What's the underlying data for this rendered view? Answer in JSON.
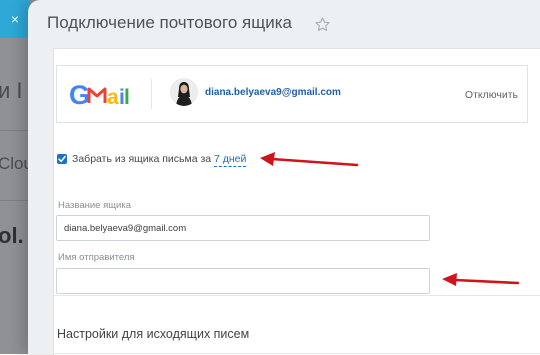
{
  "background_page": {
    "close_glyph": "×",
    "snippet_1": "и I",
    "snippet_2": "Clou",
    "snippet_3": "ol."
  },
  "panel": {
    "title": "Подключение почтового ящика",
    "star_icon": "star-outline-icon"
  },
  "account": {
    "logo_text": "Gmail",
    "email": "diana.belyaeva9@gmail.com",
    "disconnect_label": "Отключить"
  },
  "fetch": {
    "checked": true,
    "label": "Забрать из ящика письма за",
    "period": "7 дней"
  },
  "mailbox_name": {
    "label": "Название ящика",
    "value": "diana.belyaeva9@gmail.com"
  },
  "sender_name": {
    "label": "Имя отправителя",
    "value": ""
  },
  "outgoing": {
    "title": "Настройки для исходящих писем"
  },
  "colors": {
    "accent": "#1a73c8",
    "link": "#1a6fbf",
    "annotation_arrow": "#d0141c",
    "close_button": "#2fa8d8"
  }
}
